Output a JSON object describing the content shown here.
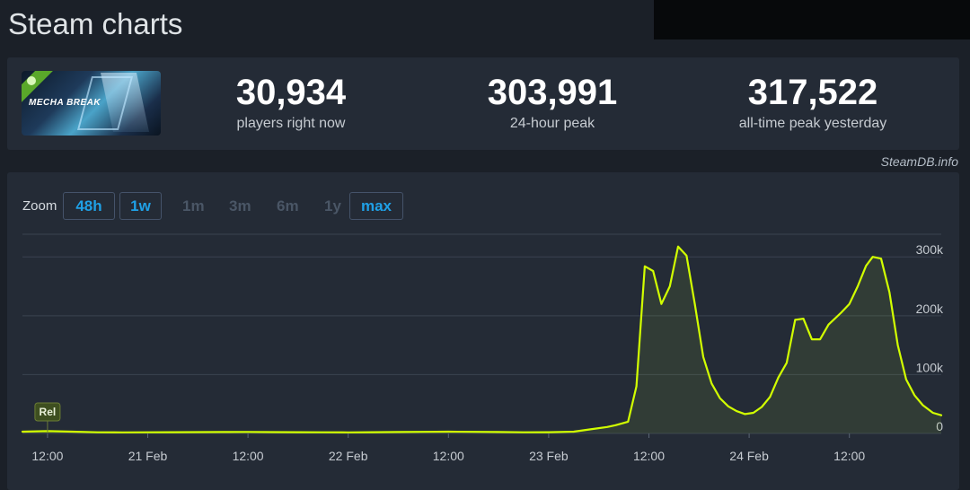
{
  "page": {
    "title": "Steam charts"
  },
  "stats": [
    {
      "value": "30,934",
      "label": "players right now"
    },
    {
      "value": "303,991",
      "label": "24-hour peak"
    },
    {
      "value": "317,522",
      "label": "all-time peak yesterday"
    }
  ],
  "game": {
    "logo_text": "MECHA BREAK"
  },
  "credit": "SteamDB.info",
  "zoom": {
    "label": "Zoom",
    "options": [
      {
        "label": "48h",
        "state": "active"
      },
      {
        "label": "1w",
        "state": "active"
      },
      {
        "label": "1m",
        "state": "disabled"
      },
      {
        "label": "3m",
        "state": "disabled"
      },
      {
        "label": "6m",
        "state": "disabled"
      },
      {
        "label": "1y",
        "state": "disabled"
      },
      {
        "label": "max",
        "state": "active"
      }
    ]
  },
  "chart_data": {
    "type": "area",
    "title": "",
    "xlabel": "",
    "ylabel": "",
    "x_unit": "hours",
    "xlim": [
      -3,
      99
    ],
    "ylim": [
      0,
      300000
    ],
    "y_ticks": [
      0,
      100000,
      200000,
      300000
    ],
    "y_tick_labels": [
      "0",
      "100k",
      "200k",
      "300k"
    ],
    "x_ticks": [
      0,
      12,
      24,
      36,
      48,
      60,
      72,
      84
    ],
    "x_tick_labels": [
      "12:00",
      "21 Feb",
      "12:00",
      "22 Feb",
      "12:00",
      "23 Feb",
      "12:00",
      "24 Feb",
      "12:00"
    ],
    "x_tick_hours": [
      0,
      12,
      24,
      36,
      48,
      60,
      72,
      84,
      96
    ],
    "grid": true,
    "line_color": "#d2ff00",
    "annotation": {
      "label": "Rel",
      "x": 0
    },
    "series": [
      {
        "values": [
          [
            -3,
            3000
          ],
          [
            0,
            4000
          ],
          [
            3,
            3000
          ],
          [
            6,
            2000
          ],
          [
            9,
            1800
          ],
          [
            12,
            2000
          ],
          [
            15,
            2200
          ],
          [
            18,
            2300
          ],
          [
            21,
            2400
          ],
          [
            24,
            2600
          ],
          [
            27,
            2300
          ],
          [
            30,
            2100
          ],
          [
            33,
            2000
          ],
          [
            36,
            1900
          ],
          [
            39,
            2100
          ],
          [
            42,
            2400
          ],
          [
            45,
            2700
          ],
          [
            48,
            3000
          ],
          [
            51,
            2700
          ],
          [
            54,
            2400
          ],
          [
            57,
            2000
          ],
          [
            60,
            2200
          ],
          [
            63,
            3000
          ],
          [
            65,
            7000
          ],
          [
            67,
            11000
          ],
          [
            68,
            14000
          ],
          [
            69.5,
            20000
          ],
          [
            70.5,
            80000
          ],
          [
            71.5,
            284000
          ],
          [
            72.5,
            276000
          ],
          [
            73.5,
            220000
          ],
          [
            74.5,
            250000
          ],
          [
            75.5,
            317522
          ],
          [
            76.5,
            302000
          ],
          [
            77.5,
            220000
          ],
          [
            78.5,
            130000
          ],
          [
            79.5,
            85000
          ],
          [
            80.5,
            60000
          ],
          [
            81.5,
            46000
          ],
          [
            82.5,
            38000
          ],
          [
            83.5,
            33000
          ],
          [
            84.5,
            35000
          ],
          [
            85.5,
            45000
          ],
          [
            86.5,
            62000
          ],
          [
            87.5,
            95000
          ],
          [
            88.5,
            120000
          ],
          [
            89.5,
            193000
          ],
          [
            90.5,
            195000
          ],
          [
            91.5,
            160000
          ],
          [
            92.5,
            160000
          ],
          [
            93.5,
            185000
          ],
          [
            95,
            205000
          ],
          [
            96,
            220000
          ],
          [
            97,
            250000
          ],
          [
            98,
            285000
          ],
          [
            98.8,
            300000
          ],
          [
            99.8,
            297000
          ],
          [
            100.8,
            240000
          ],
          [
            101.8,
            150000
          ],
          [
            102.8,
            92000
          ],
          [
            103.8,
            65000
          ],
          [
            104.8,
            48000
          ],
          [
            106,
            35000
          ],
          [
            107,
            30934
          ]
        ]
      }
    ]
  }
}
